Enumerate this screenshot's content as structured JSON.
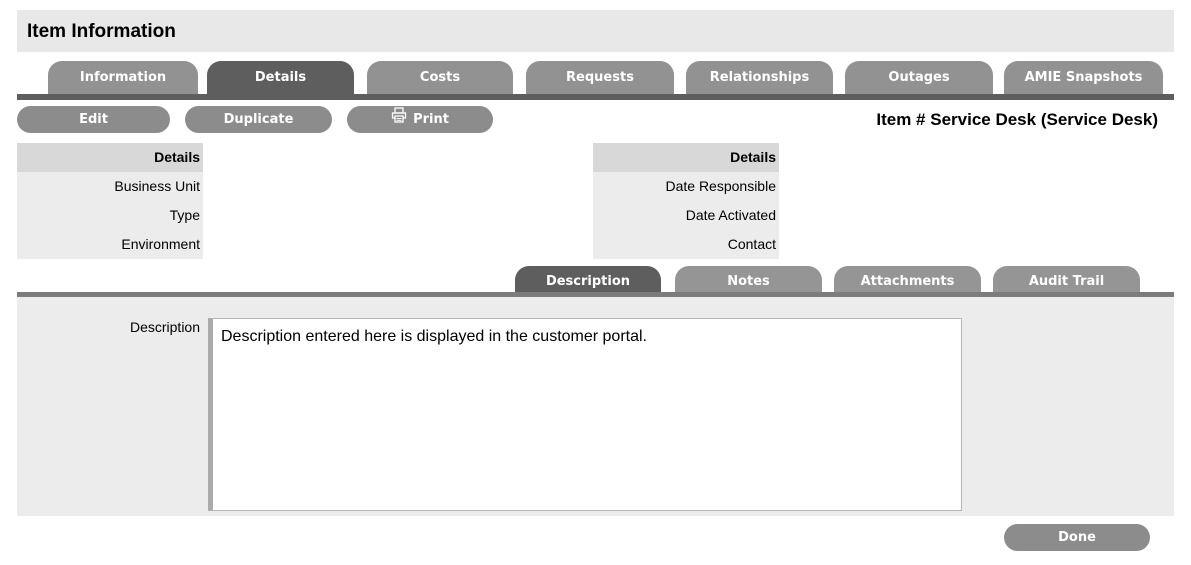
{
  "page": {
    "title": "Item Information"
  },
  "tabs": [
    {
      "label": "Information",
      "active": false
    },
    {
      "label": "Details",
      "active": true
    },
    {
      "label": "Costs",
      "active": false
    },
    {
      "label": "Requests",
      "active": false
    },
    {
      "label": "Relationships",
      "active": false
    },
    {
      "label": "Outages",
      "active": false
    },
    {
      "label": "AMIE Snapshots",
      "active": false
    }
  ],
  "toolbar": {
    "edit_label": "Edit",
    "duplicate_label": "Duplicate",
    "print_label": "Print",
    "print_icon": "printer-icon"
  },
  "item_number": "Item # Service Desk (Service Desk)",
  "details_left": {
    "header": "Details",
    "rows": [
      {
        "label": "Business Unit",
        "value": ""
      },
      {
        "label": "Type",
        "value": ""
      },
      {
        "label": "Environment",
        "value": ""
      }
    ]
  },
  "details_right": {
    "header": "Details",
    "rows": [
      {
        "label": "Date Responsible",
        "value": ""
      },
      {
        "label": "Date Activated",
        "value": ""
      },
      {
        "label": "Contact",
        "value": ""
      }
    ]
  },
  "subtabs": [
    {
      "label": "Description",
      "active": true
    },
    {
      "label": "Notes",
      "active": false
    },
    {
      "label": "Attachments",
      "active": false
    },
    {
      "label": "Audit Trail",
      "active": false
    }
  ],
  "description": {
    "label": "Description",
    "value": "Description entered here is displayed in the customer portal."
  },
  "footer": {
    "done_label": "Done"
  },
  "colors": {
    "tab_active": "#5e5e5e",
    "tab_inactive": "#929292",
    "header_cell": "#d8d8d8",
    "row_cell": "#ececec"
  }
}
